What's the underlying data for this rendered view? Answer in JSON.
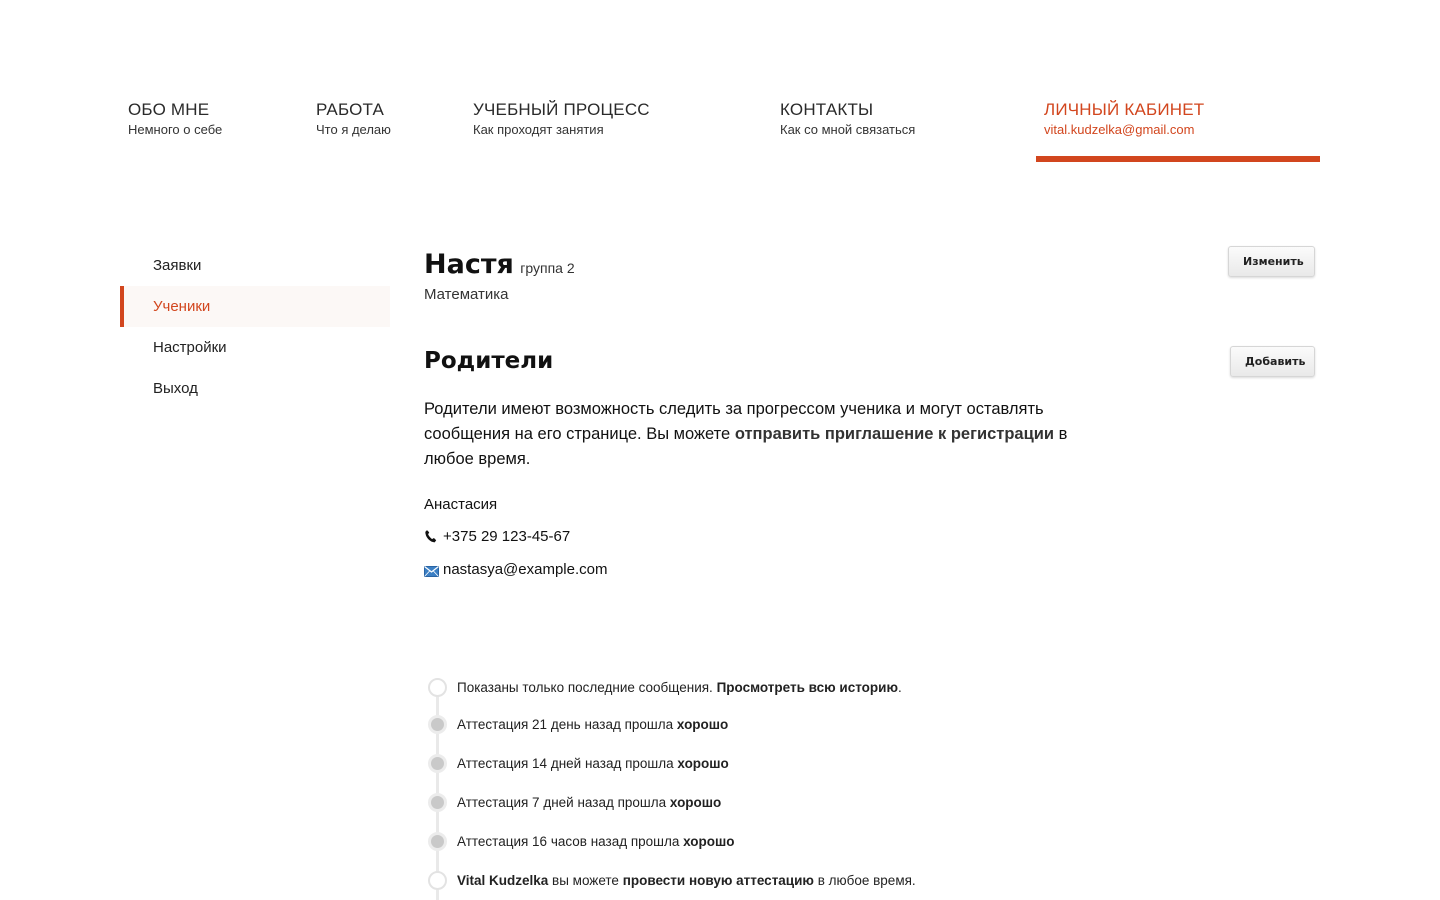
{
  "nav": {
    "items": [
      {
        "title": "ОБО МНЕ",
        "sub": "Немного о себе"
      },
      {
        "title": "РАБОТА",
        "sub": "Что я делаю"
      },
      {
        "title": "УЧЕБНЫЙ ПРОЦЕСС",
        "sub": "Как проходят занятия"
      },
      {
        "title": "КОНТАКТЫ",
        "sub": "Как со мной связаться"
      },
      {
        "title": "ЛИЧНЫЙ КАБИНЕТ",
        "sub": "vital.kudzelka@gmail.com"
      }
    ],
    "active_index": 4,
    "accent_color": "#d2461e"
  },
  "sidebar": {
    "items": [
      {
        "label": "Заявки"
      },
      {
        "label": "Ученики"
      },
      {
        "label": "Настройки"
      },
      {
        "label": "Выход"
      }
    ],
    "active_index": 1
  },
  "student": {
    "name": "Настя",
    "group": "группа 2",
    "subject": "Математика",
    "edit_label": "Изменить"
  },
  "parents": {
    "title": "Родители",
    "add_label": "Добавить",
    "text_before": "Родители имеют возможность следить за прогрессом ученика и могут оставлять сообщения на его странице. Вы можете ",
    "text_link": "отправить приглашение к регистрации",
    "text_after": " в любое время.",
    "parent_name": "Анастасия",
    "phone": "+375 29 123-45-67",
    "email": "nastasya@example.com",
    "phone_icon": "phone-icon",
    "email_icon": "envelope-icon"
  },
  "timeline": {
    "header_text": "Показаны только последние сообщения. ",
    "header_link": "Просмотреть всю историю",
    "header_end": ".",
    "entries": [
      {
        "text": "Аттестация 21 день назад прошла ",
        "result": "хорошо"
      },
      {
        "text": "Аттестация 14 дней назад прошла ",
        "result": "хорошо"
      },
      {
        "text": "Аттестация 7 дней назад прошла ",
        "result": "хорошо"
      },
      {
        "text": "Аттестация 16 часов назад прошла ",
        "result": "хорошо"
      }
    ],
    "footer_user": "Vital Kudzelka",
    "footer_mid": " вы можете ",
    "footer_link": "провести новую аттестацию",
    "footer_end": " в любое время."
  }
}
